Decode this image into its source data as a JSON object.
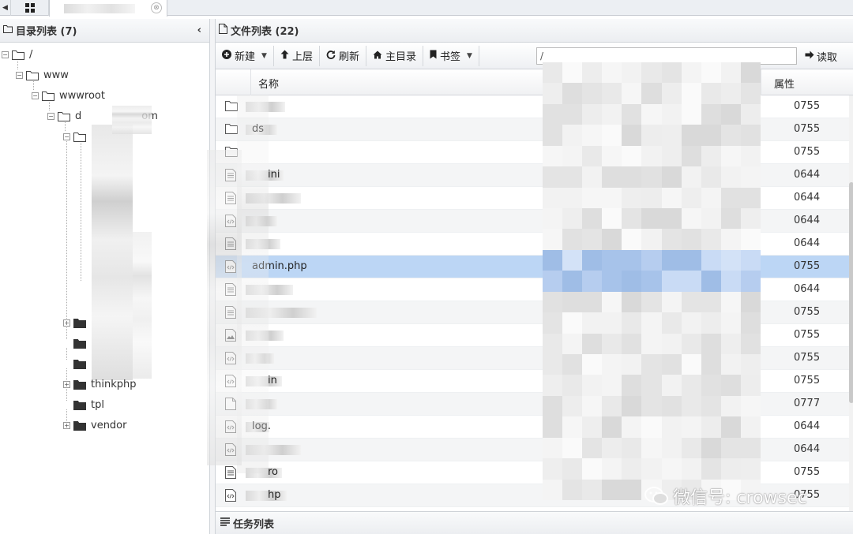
{
  "tabbar": {
    "grid_icon": "grid-icon",
    "close_glyph": "⊗"
  },
  "left": {
    "title": "目录列表 (7)",
    "collapse_glyph": "‹",
    "tree": {
      "root": "/",
      "www": "www",
      "wwwroot": "wwwroot",
      "site_prefix": "d",
      "site_suffix": "om",
      "thinkphp": "thinkphp",
      "tpl": "tpl",
      "vendor": "vendor"
    }
  },
  "right": {
    "title": "文件列表 (22)",
    "toolbar": {
      "new": "新建",
      "up": "上层",
      "refresh": "刷新",
      "home": "主目录",
      "bookmark": "书签",
      "path_value": "/",
      "read": "读取"
    },
    "columns": {
      "name": "名称",
      "attr": "属性"
    },
    "files": [
      {
        "type": "folder",
        "name": "",
        "attr": "0755"
      },
      {
        "type": "folder",
        "name": "ds",
        "attr": "0755"
      },
      {
        "type": "folder",
        "name": "",
        "attr": "0755"
      },
      {
        "type": "text",
        "name": "ini",
        "attr": "0644"
      },
      {
        "type": "text",
        "name": "",
        "attr": "0644"
      },
      {
        "type": "code",
        "name": "",
        "attr": "0644"
      },
      {
        "type": "text",
        "name": "",
        "attr": "0644"
      },
      {
        "type": "code",
        "name": "admin.php",
        "attr": "0755",
        "selected": true
      },
      {
        "type": "text",
        "name": "",
        "attr": "0644"
      },
      {
        "type": "text",
        "name": "",
        "attr": "0755"
      },
      {
        "type": "image",
        "name": "",
        "attr": "0755"
      },
      {
        "type": "code",
        "name": "",
        "attr": "0755"
      },
      {
        "type": "code",
        "name": "in",
        "attr": "0755"
      },
      {
        "type": "blank",
        "name": "",
        "attr": "0777"
      },
      {
        "type": "code",
        "name": "log.",
        "attr": "0644"
      },
      {
        "type": "code",
        "name": "",
        "attr": "0644"
      },
      {
        "type": "text",
        "name": "ro",
        "attr": "0755"
      },
      {
        "type": "code",
        "name": "hp",
        "attr": "0755"
      }
    ]
  },
  "taskbar": {
    "title": "任务列表"
  },
  "watermark": {
    "text": "微信号: crowsec"
  },
  "colors": {
    "selected_row": "#bcd6f5",
    "header_bg": "#eceef1",
    "alt_row": "#f4f5f6"
  }
}
